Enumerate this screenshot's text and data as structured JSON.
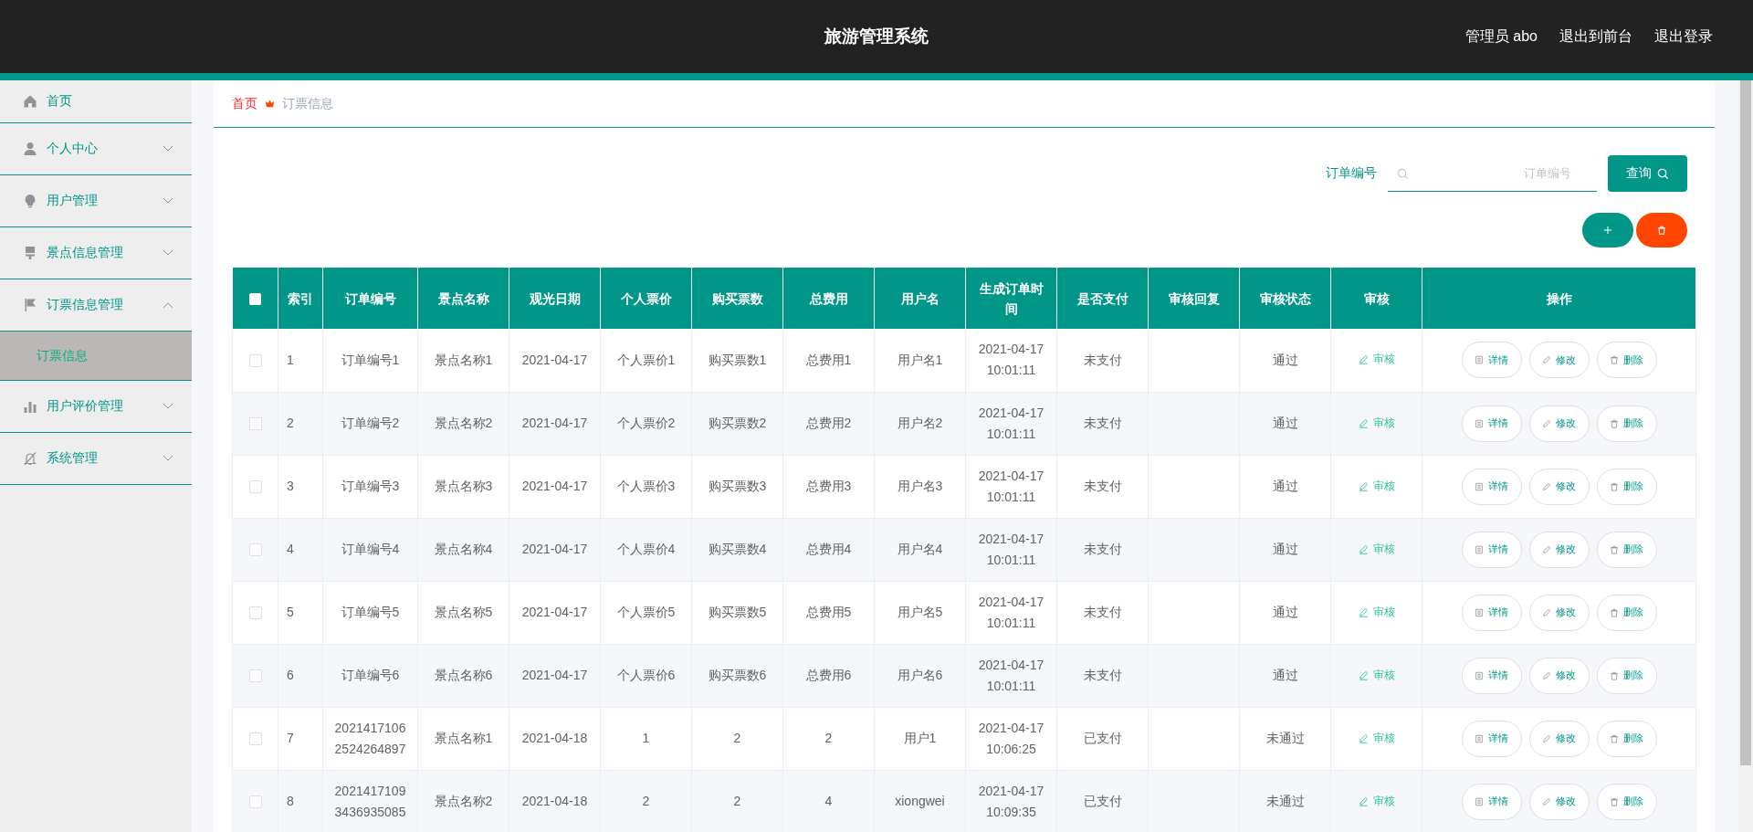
{
  "header": {
    "title": "旅游管理系统",
    "links": [
      "管理员 abo",
      "退出到前台",
      "退出登录"
    ]
  },
  "sidebar": {
    "items": [
      {
        "label": "首页"
      },
      {
        "label": "个人中心",
        "expanded": false
      },
      {
        "label": "用户管理",
        "expanded": false
      },
      {
        "label": "景点信息管理",
        "expanded": false
      },
      {
        "label": "订票信息管理",
        "expanded": true,
        "children": [
          {
            "label": "订票信息",
            "selected": true
          }
        ]
      },
      {
        "label": "用户评价管理",
        "expanded": false
      },
      {
        "label": "系统管理",
        "expanded": false
      }
    ]
  },
  "breadcrumb": [
    "首页",
    "订票信息"
  ],
  "search": {
    "label": "订单编号",
    "placeholder": "订单编号",
    "button": "查询"
  },
  "table": {
    "header_checkbox": {
      "checked": false
    },
    "columns": [
      "索引",
      "订单编号",
      "景点名称",
      "观光日期",
      "个人票价",
      "购买票数",
      "总费用",
      "用户名",
      "生成订单时间",
      "是否支付",
      "审核回复",
      "审核状态",
      "审核",
      "操作"
    ],
    "rows": [
      {
        "checked": false,
        "index": "1",
        "order_no": "订单编号1",
        "spot": "景点名称1",
        "date": "2021-04-17",
        "price": "个人票价1",
        "count": "购买票数1",
        "total": "总费用1",
        "user": "用户名1",
        "created": "2021-04-17 10:01:11",
        "paid": "未支付",
        "status": "通过",
        "review": "审核",
        "actions": [
          "详情",
          "修改",
          "删除"
        ]
      },
      {
        "checked": false,
        "index": "2",
        "order_no": "订单编号2",
        "spot": "景点名称2",
        "date": "2021-04-17",
        "price": "个人票价2",
        "count": "购买票数2",
        "total": "总费用2",
        "user": "用户名2",
        "created": "2021-04-17 10:01:11",
        "paid": "未支付",
        "status": "通过",
        "review": "审核",
        "actions": [
          "详情",
          "修改",
          "删除"
        ]
      },
      {
        "checked": false,
        "index": "3",
        "order_no": "订单编号3",
        "spot": "景点名称3",
        "date": "2021-04-17",
        "price": "个人票价3",
        "count": "购买票数3",
        "total": "总费用3",
        "user": "用户名3",
        "created": "2021-04-17 10:01:11",
        "paid": "未支付",
        "status": "通过",
        "review": "审核",
        "actions": [
          "详情",
          "修改",
          "删除"
        ]
      },
      {
        "checked": false,
        "index": "4",
        "order_no": "订单编号4",
        "spot": "景点名称4",
        "date": "2021-04-17",
        "price": "个人票价4",
        "count": "购买票数4",
        "total": "总费用4",
        "user": "用户名4",
        "created": "2021-04-17 10:01:11",
        "paid": "未支付",
        "status": "通过",
        "review": "审核",
        "actions": [
          "详情",
          "修改",
          "删除"
        ]
      },
      {
        "checked": false,
        "index": "5",
        "order_no": "订单编号5",
        "spot": "景点名称5",
        "date": "2021-04-17",
        "price": "个人票价5",
        "count": "购买票数5",
        "total": "总费用5",
        "user": "用户名5",
        "created": "2021-04-17 10:01:11",
        "paid": "未支付",
        "status": "通过",
        "review": "审核",
        "actions": [
          "详情",
          "修改",
          "删除"
        ]
      },
      {
        "checked": false,
        "index": "6",
        "order_no": "订单编号6",
        "spot": "景点名称6",
        "date": "2021-04-17",
        "price": "个人票价6",
        "count": "购买票数6",
        "total": "总费用6",
        "user": "用户名6",
        "created": "2021-04-17 10:01:11",
        "paid": "未支付",
        "status": "通过",
        "review": "审核",
        "actions": [
          "详情",
          "修改",
          "删除"
        ]
      },
      {
        "checked": false,
        "index": "7",
        "order_no": "20214171062524264897",
        "spot": "景点名称1",
        "date": "2021-04-18",
        "price": "1",
        "count": "2",
        "total": "2",
        "user": "用户1",
        "created": "2021-04-17 10:06:25",
        "paid": "已支付",
        "status": "未通过",
        "review": "审核",
        "actions": [
          "详情",
          "修改",
          "删除"
        ]
      },
      {
        "checked": false,
        "index": "8",
        "order_no": "20214171093436935085",
        "spot": "景点名称2",
        "date": "2021-04-18",
        "price": "2",
        "count": "2",
        "total": "4",
        "user": "xiongwei",
        "created": "2021-04-17 10:09:35",
        "paid": "已支付",
        "status": "未通过",
        "review": "审核",
        "actions": [
          "详情",
          "修改",
          "删除"
        ]
      }
    ]
  }
}
